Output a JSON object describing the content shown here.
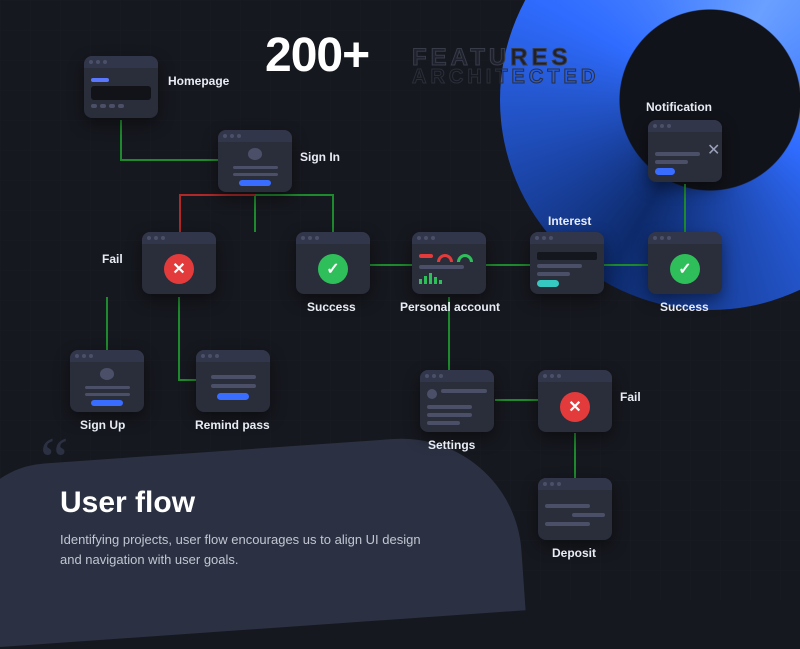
{
  "headline": {
    "count": "200+",
    "features": "FEATURES",
    "architected": "ARCHITECTED"
  },
  "footer": {
    "title": "User flow",
    "body": "Identifying projects, user flow encourages us to align UI design and navigation with user goals."
  },
  "nodes": {
    "homepage": "Homepage",
    "signin": "Sign In",
    "fail": "Fail",
    "success": "Success",
    "account": "Personal account",
    "interest": "Interest",
    "notification": "Notification",
    "signup": "Sign Up",
    "remind": "Remind pass",
    "settings": "Settings",
    "deposit": "Deposit"
  },
  "colors": {
    "success_line": "#1f8a2d",
    "fail_line": "#b02828",
    "accent": "#396dff"
  }
}
